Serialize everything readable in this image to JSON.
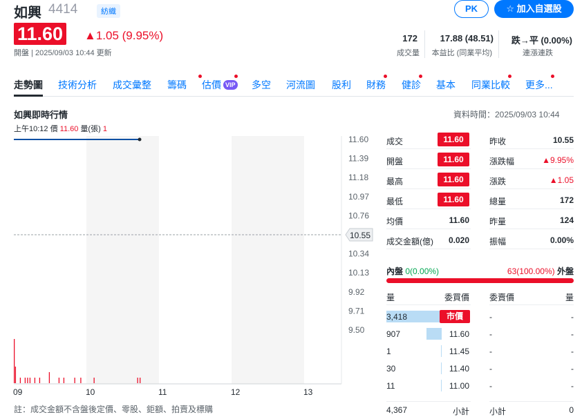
{
  "header": {
    "name": "如興",
    "code": "4414",
    "badge": "紡織",
    "pk_label": "PK",
    "watchlist_label": "☆ 加入自選股",
    "price": "11.60",
    "change": "▲1.05 (9.95%)",
    "status": "開盤 | 2025/09/03 10:44 更新"
  },
  "stats": [
    {
      "value": "172",
      "label": "成交量"
    },
    {
      "value": "17.88 (48.51)",
      "label": "本益比 (同業平均)"
    },
    {
      "value": "跌→平 (0.00%)",
      "label": "連漲連跌"
    }
  ],
  "tabs": [
    "走勢圖",
    "技術分析",
    "成交彙整",
    "籌碼",
    "估價",
    "多空",
    "河流圖",
    "股利",
    "財務",
    "健診",
    "基本",
    "同業比較",
    "更多..."
  ],
  "vip_label": "VIP",
  "chart": {
    "title": "如興即時行情",
    "data_time": "資料時間：2025/09/03 10:44",
    "tooltip": {
      "time": "上午10:12",
      "price_label": "價",
      "price": "11.60",
      "vol_label": "量(張)",
      "vol": "1"
    },
    "current_tag": "10.55",
    "note": "註：成交金額不含盤後定價、零股、鉅額、拍賣及標購"
  },
  "chart_data": {
    "type": "line",
    "x_ticks": [
      "09",
      "10",
      "11",
      "12",
      "13"
    ],
    "y_ticks": [
      "11.60",
      "11.39",
      "11.18",
      "10.97",
      "10.76",
      "10.55",
      "10.34",
      "10.13",
      "9.92",
      "9.71",
      "9.50"
    ],
    "ylim": [
      9.5,
      11.6
    ],
    "reference_price": 10.55,
    "price_line": {
      "x": [
        "09:00",
        "10:44"
      ],
      "y": [
        11.6,
        11.6
      ]
    },
    "volume_bars_minutes": [
      [
        0,
        8
      ],
      [
        1,
        3
      ],
      [
        5,
        1
      ],
      [
        9,
        1
      ],
      [
        11,
        1
      ],
      [
        13,
        1
      ],
      [
        17,
        1
      ],
      [
        21,
        1
      ],
      [
        29,
        2
      ],
      [
        37,
        1
      ],
      [
        41,
        1
      ],
      [
        50,
        1
      ],
      [
        55,
        1
      ],
      [
        66,
        1
      ],
      [
        102,
        1
      ],
      [
        104,
        1
      ]
    ]
  },
  "quote": {
    "left": [
      {
        "label": "成交",
        "value": "11.60",
        "pill": true
      },
      {
        "label": "開盤",
        "value": "11.60",
        "pill": true
      },
      {
        "label": "最高",
        "value": "11.60",
        "pill": true
      },
      {
        "label": "最低",
        "value": "11.60",
        "pill": true
      },
      {
        "label": "均價",
        "value": "11.60",
        "pill": false
      },
      {
        "label": "成交金額(億)",
        "value": "0.020",
        "pill": false
      }
    ],
    "right": [
      {
        "label": "昨收",
        "value": "10.55",
        "red": false
      },
      {
        "label": "漲跌幅",
        "value": "▲9.95%",
        "red": true
      },
      {
        "label": "漲跌",
        "value": "▲1.05",
        "red": true
      },
      {
        "label": "總量",
        "value": "172",
        "red": false
      },
      {
        "label": "昨量",
        "value": "124",
        "red": false
      },
      {
        "label": "振幅",
        "value": "0.00%",
        "red": false
      }
    ]
  },
  "inner_outer": {
    "inner_label": "內盤",
    "inner_value": "0(0.00%)",
    "outer_value": "63(100.00%)",
    "outer_label": "外盤"
  },
  "orderbook": {
    "headers": [
      "量",
      "委買價",
      "委賣價",
      "量"
    ],
    "rows": [
      {
        "bid_vol": "3,418",
        "bid_price": "市價",
        "bid_fill": 1.0,
        "ask_price": "-",
        "ask_vol": "-"
      },
      {
        "bid_vol": "907",
        "bid_price": "11.60",
        "bid_fill": 0.27,
        "ask_price": "-",
        "ask_vol": "-"
      },
      {
        "bid_vol": "1",
        "bid_price": "11.45",
        "bid_fill": 0.0,
        "ask_price": "-",
        "ask_vol": "-"
      },
      {
        "bid_vol": "30",
        "bid_price": "11.40",
        "bid_fill": 0.01,
        "ask_price": "-",
        "ask_vol": "-"
      },
      {
        "bid_vol": "11",
        "bid_price": "11.00",
        "bid_fill": 0.004,
        "ask_price": "-",
        "ask_vol": "-"
      }
    ],
    "total_bid": "4,367",
    "subtotal_label": "小計",
    "total_ask": "0"
  },
  "colors": {
    "up": "#eb0f29",
    "accent": "#0078ff",
    "bar_fill": "#b9dcf5"
  }
}
